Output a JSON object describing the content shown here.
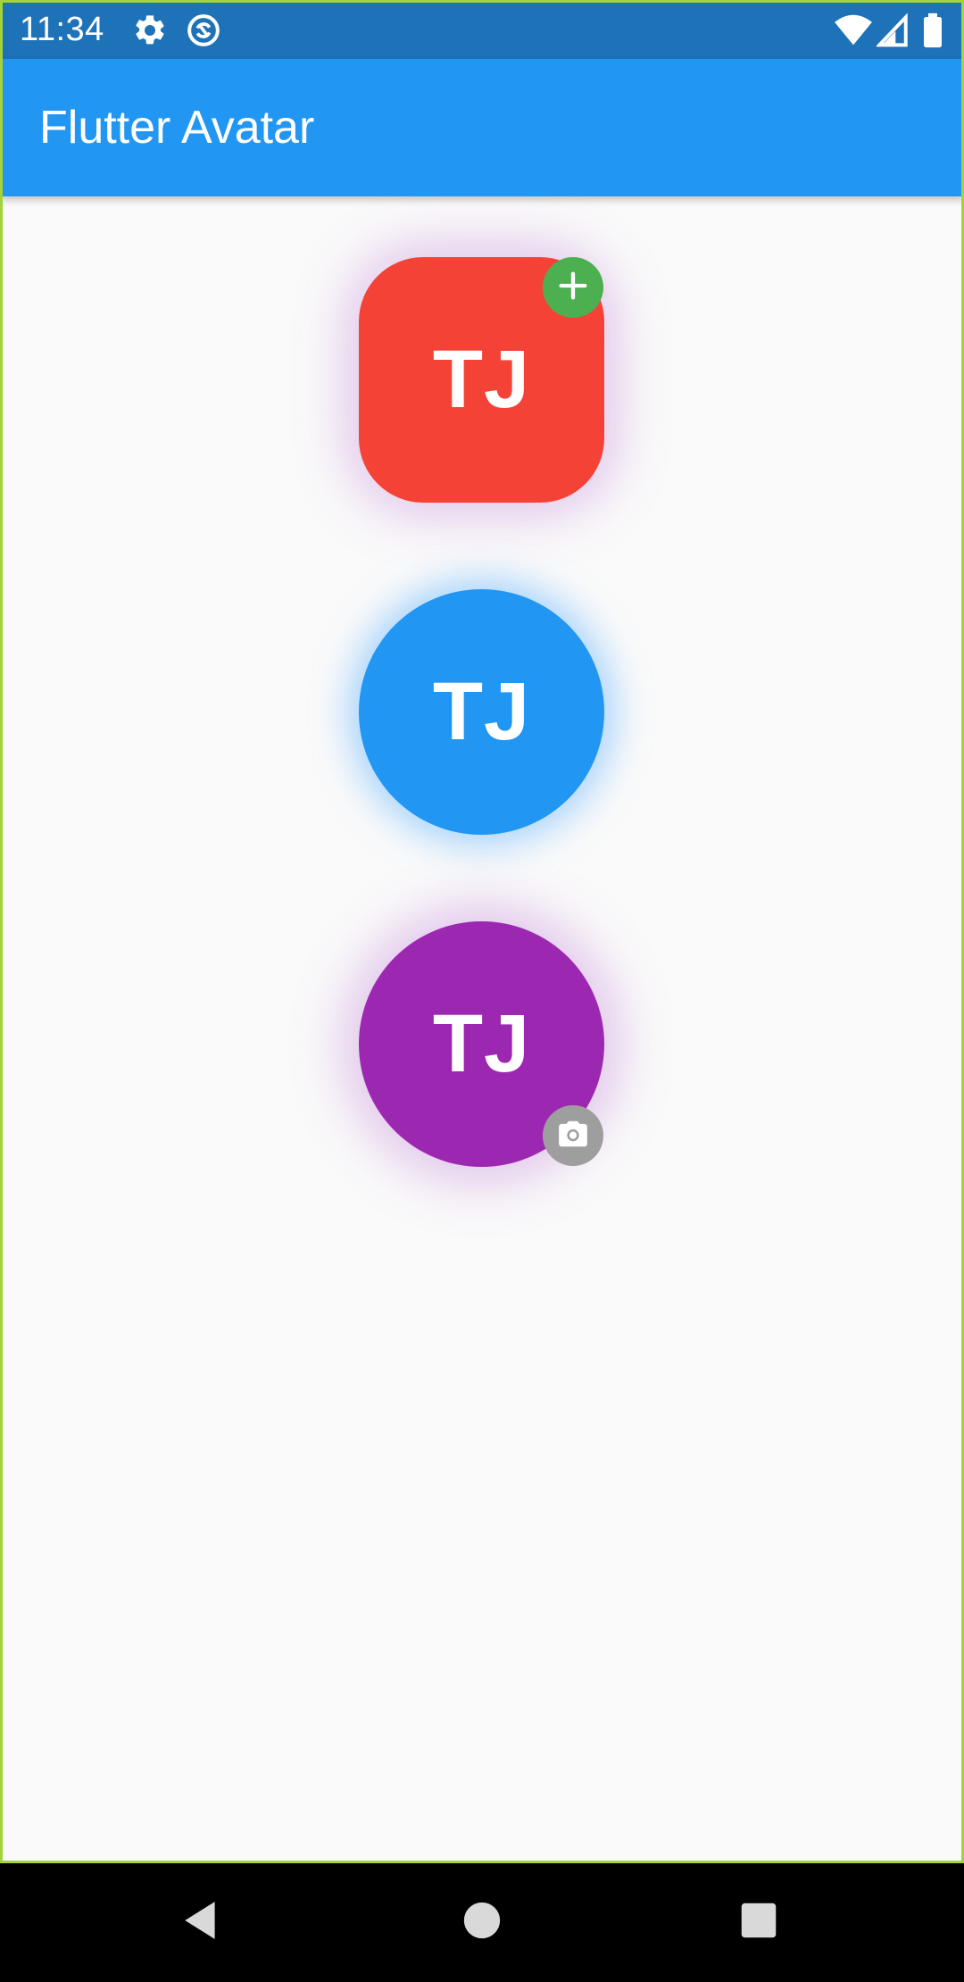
{
  "status_bar": {
    "time": "11:34",
    "color": "#1d72b8",
    "icons_left": [
      "gear-icon",
      "sync-icon"
    ],
    "icons_right": [
      "wifi-icon",
      "signal-icon",
      "battery-icon"
    ]
  },
  "app_bar": {
    "title": "Flutter Avatar",
    "color": "#2196f3"
  },
  "avatars": [
    {
      "initials": "TJ",
      "color": "#f44336",
      "shape": "rounded-square",
      "badge": "add-icon",
      "badge_color": "#4caf50"
    },
    {
      "initials": "TJ",
      "color": "#2196f3",
      "shape": "circle",
      "badge": null
    },
    {
      "initials": "TJ",
      "color": "#9c27b0",
      "shape": "circle",
      "badge": "camera-icon",
      "badge_color": "#9e9e9e"
    }
  ],
  "nav_bar": {
    "buttons": [
      "back-icon",
      "home-icon",
      "recents-icon"
    ]
  }
}
